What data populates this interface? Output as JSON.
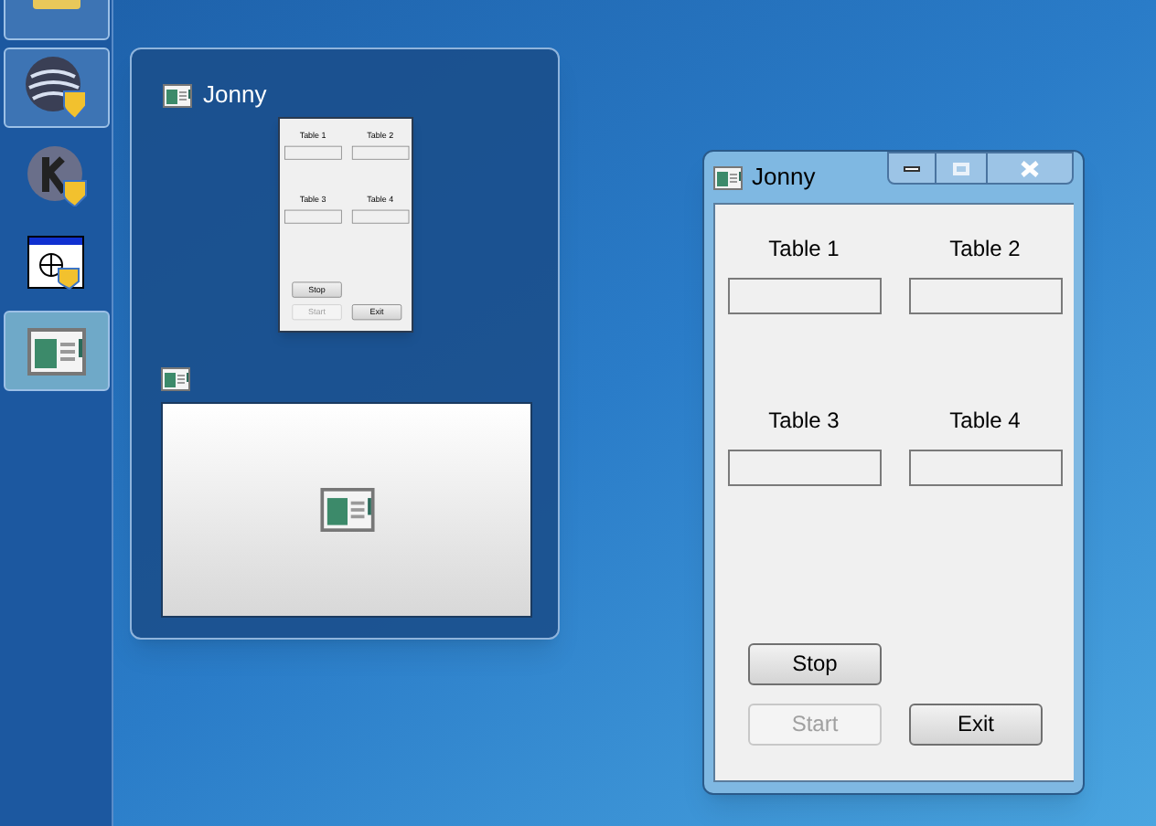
{
  "taskbar": {
    "items": [
      {
        "kind": "printer",
        "highlighted": true,
        "selected": false
      },
      {
        "kind": "globe",
        "highlighted": true,
        "selected": false
      },
      {
        "kind": "letter-k",
        "highlighted": false,
        "selected": false
      },
      {
        "kind": "dialog",
        "highlighted": false,
        "selected": false
      },
      {
        "kind": "app-window",
        "highlighted": true,
        "selected": true
      }
    ]
  },
  "thumbnail_popup": {
    "thumbnails": [
      {
        "kind": "form-preview",
        "title": "Jonny",
        "preview": {
          "tables": [
            "Table 1",
            "Table 2",
            "Table 3",
            "Table 4"
          ],
          "buttons": [
            {
              "label": "Stop",
              "disabled": false
            },
            {
              "label": "Start",
              "disabled": true
            },
            {
              "label": "Exit",
              "disabled": false
            }
          ]
        }
      },
      {
        "kind": "blank-preview"
      }
    ]
  },
  "window": {
    "title": "Jonny",
    "tables": [
      "Table 1",
      "Table 2",
      "Table 3",
      "Table 4"
    ],
    "buttons": [
      {
        "label": "Stop",
        "disabled": false
      },
      {
        "label": "Start",
        "disabled": true
      },
      {
        "label": "Exit",
        "disabled": false
      }
    ]
  }
}
